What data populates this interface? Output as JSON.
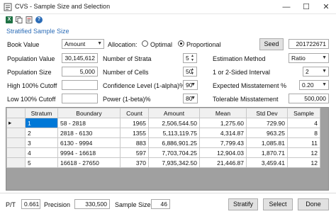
{
  "window": {
    "title": "CVS - Sample Size and Selection",
    "minimize_glyph": "—",
    "maximize_glyph": "☐",
    "close_glyph": "✕"
  },
  "toolbar": {
    "icons": [
      "excel-icon",
      "copy-icon",
      "document-icon",
      "help-icon"
    ],
    "excel_color": "#1f7244",
    "help_color": "#2b6cb7"
  },
  "section": {
    "label": "Stratified Sample Size"
  },
  "form": {
    "book_value_label": "Book Value",
    "book_value_selected": "Amount",
    "allocation_label": "Allocation:",
    "optimal_label": "Optimal",
    "proportional_label": "Proportional",
    "seed_button": "Seed",
    "seed_value": "201722671",
    "population_value_label": "Population Value",
    "population_value": "30,145,612",
    "number_of_strata_label": "Number of Strata",
    "number_of_strata": "5",
    "estimation_method_label": "Estimation Method",
    "estimation_method": "Ratio",
    "population_size_label": "Population Size",
    "population_size": "5,000",
    "number_of_cells_label": "Number of Cells",
    "number_of_cells": "50",
    "sided_interval_label": "1 or 2-Sided Interval",
    "sided_interval": "2",
    "high_cutoff_label": "High 100% Cutoff",
    "high_cutoff": "",
    "confidence_label": "Confidence Level (1-alpha)%",
    "confidence": "90",
    "expected_misstatement_label": "Expected Misstatement %",
    "expected_misstatement": "0.20",
    "low_cutoff_label": "Low 100% Cutoff",
    "low_cutoff": "",
    "power_label": "Power (1-beta)%",
    "power": "80",
    "tolerable_misstatement_label": "Tolerable Misstatement",
    "tolerable_misstatement": "500,000"
  },
  "grid": {
    "columns": [
      "Stratum",
      "Boundary",
      "Count",
      "Amount",
      "Mean",
      "Std Dev",
      "Sample"
    ],
    "row_indicator": "▸",
    "rows": [
      [
        "1",
        "58 - 2818",
        "1965",
        "2,506,544.50",
        "1,275.60",
        "729.90",
        "4"
      ],
      [
        "2",
        "2818 - 6130",
        "1355",
        "5,113,119.75",
        "4,314.87",
        "963.25",
        "8"
      ],
      [
        "3",
        "6130 - 9994",
        "883",
        "6,886,901.25",
        "7,799.43",
        "1,085.81",
        "11"
      ],
      [
        "4",
        "9994 - 16618",
        "597",
        "7,703,704.25",
        "12,904.03",
        "1,870.71",
        "12"
      ],
      [
        "5",
        "16618 - 27650",
        "370",
        "7,935,342.50",
        "21,446.87",
        "3,459.41",
        "12"
      ]
    ]
  },
  "footer": {
    "pt_label": "P/T",
    "pt_value": "0.661",
    "precision_label": "Precision",
    "precision_value": "330,500",
    "sample_size_label": "Sample Size",
    "sample_size_value": "46",
    "stratify_button": "Stratify",
    "select_button": "Select",
    "done_button": "Done"
  }
}
